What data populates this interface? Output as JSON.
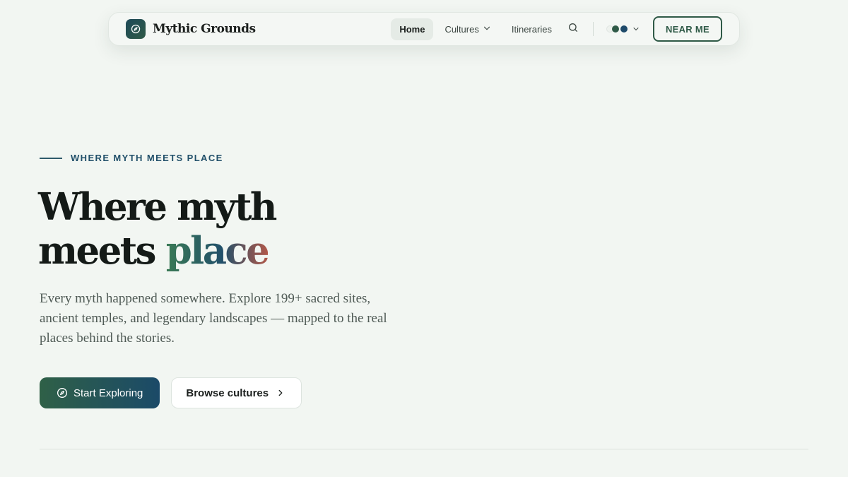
{
  "nav": {
    "brand": "Mythic Grounds",
    "links": [
      {
        "label": "Home",
        "active": true
      },
      {
        "label": "Cultures",
        "has_dropdown": true
      },
      {
        "label": "Itineraries"
      }
    ],
    "near_me_label": "NEAR ME"
  },
  "hero": {
    "eyebrow": "WHERE MYTH MEETS PLACE",
    "headline_line1": "Where myth",
    "headline_line2_plain": "meets ",
    "headline_line2_accent": "place",
    "lede": "Every myth happened somewhere. Explore 199+ sacred sites, ancient temples, and legendary landscapes — mapped to the real places behind the stories.",
    "primary_cta": "Start Exploring",
    "secondary_cta": "Browse cultures"
  },
  "colors": {
    "background": "#f2f6f2",
    "brand_green": "#2f5a47",
    "brand_blue": "#1e4a6a",
    "accent_terracotta": "#b0584a"
  },
  "icons": {
    "brand": "compass-icon",
    "search": "search-icon",
    "dropdown": "chevron-down-icon",
    "theme": "theme-dots-icon",
    "primary_cta": "compass-icon",
    "secondary_cta": "chevron-right-icon"
  }
}
